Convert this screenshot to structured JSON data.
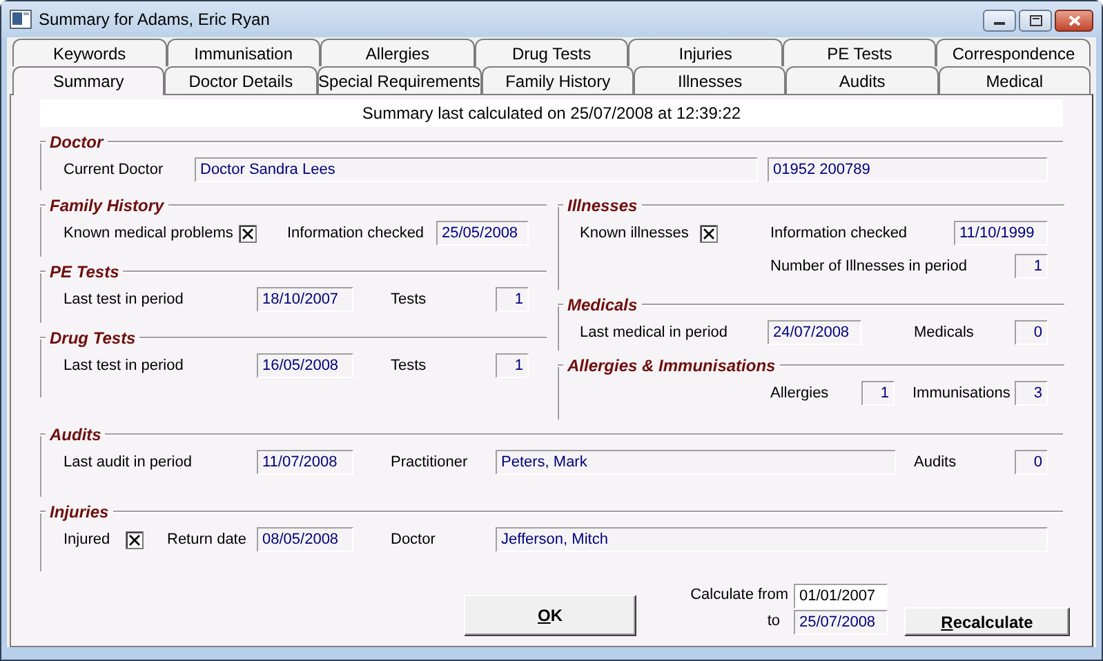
{
  "window": {
    "title": "Summary for Adams, Eric Ryan"
  },
  "tab_rows": [
    {
      "tabs": [
        {
          "label": "Keywords",
          "selected": false
        },
        {
          "label": "Immunisation",
          "selected": false
        },
        {
          "label": "Allergies",
          "selected": false
        },
        {
          "label": "Drug Tests",
          "selected": false
        },
        {
          "label": "Injuries",
          "selected": false
        },
        {
          "label": "PE Tests",
          "selected": false
        },
        {
          "label": "Correspondence",
          "selected": false
        }
      ]
    },
    {
      "tabs": [
        {
          "label": "Summary",
          "selected": true
        },
        {
          "label": "Doctor Details",
          "selected": false
        },
        {
          "label": "Special Requirements",
          "selected": false
        },
        {
          "label": "Family History",
          "selected": false
        },
        {
          "label": "Illnesses",
          "selected": false
        },
        {
          "label": "Audits",
          "selected": false
        },
        {
          "label": "Medical",
          "selected": false
        }
      ]
    }
  ],
  "summary_line": "Summary last calculated on 25/07/2008 at 12:39:22",
  "top_groups": [
    {
      "title": "Doctor",
      "rows": [
        [
          {
            "kind": "label",
            "text": "Current Doctor"
          },
          {
            "kind": "text",
            "value": "Doctor Sandra Lees"
          },
          {
            "kind": "text",
            "value": "01952 200789"
          }
        ]
      ]
    }
  ],
  "left_column": [
    {
      "title": "Family History",
      "rows": [
        [
          {
            "kind": "label",
            "text": "Known medical problems"
          },
          {
            "kind": "checkbox",
            "checked": true
          },
          {
            "kind": "label",
            "text": "Information checked"
          },
          {
            "kind": "date",
            "value": "25/05/2008"
          }
        ]
      ]
    },
    {
      "title": "PE Tests",
      "rows": [
        [
          {
            "kind": "label",
            "text": "Last test in period"
          },
          {
            "kind": "date",
            "value": "18/10/2007"
          },
          {
            "kind": "label",
            "text": "Tests"
          },
          {
            "kind": "number",
            "value": "1"
          }
        ]
      ]
    },
    {
      "title": "Drug Tests",
      "rows": [
        [
          {
            "kind": "label",
            "text": "Last test in period"
          },
          {
            "kind": "date",
            "value": "16/05/2008"
          },
          {
            "kind": "label",
            "text": "Tests"
          },
          {
            "kind": "number",
            "value": "1"
          }
        ]
      ]
    }
  ],
  "right_column": [
    {
      "title": "Illnesses",
      "rows": [
        [
          {
            "kind": "label",
            "text": "Known illnesses"
          },
          {
            "kind": "checkbox",
            "checked": true
          },
          {
            "kind": "label",
            "text": "Information checked"
          },
          {
            "kind": "date",
            "value": "11/10/1999"
          }
        ],
        [
          {
            "kind": "empty"
          },
          {
            "kind": "empty"
          },
          {
            "kind": "label",
            "text": "Number of Illnesses in period"
          },
          {
            "kind": "number",
            "value": "1"
          }
        ]
      ]
    },
    {
      "title": "Medicals",
      "rows": [
        [
          {
            "kind": "label",
            "text": "Last medical in period"
          },
          {
            "kind": "date",
            "value": "24/07/2008"
          },
          {
            "kind": "label",
            "text": "Medicals"
          },
          {
            "kind": "number",
            "value": "0"
          }
        ]
      ]
    },
    {
      "title": "Allergies & Immunisations",
      "rows": [
        [
          {
            "kind": "label",
            "text": "Allergies"
          },
          {
            "kind": "number",
            "value": "1"
          },
          {
            "kind": "label",
            "text": "Immunisations"
          },
          {
            "kind": "number",
            "value": "3"
          }
        ]
      ]
    }
  ],
  "bottom_groups": [
    {
      "title": "Audits",
      "rows": [
        [
          {
            "kind": "label",
            "text": "Last audit in period"
          },
          {
            "kind": "date",
            "value": "11/07/2008"
          },
          {
            "kind": "label",
            "text": "Practitioner"
          },
          {
            "kind": "text",
            "value": "Peters, Mark"
          },
          {
            "kind": "label",
            "text": "Audits"
          },
          {
            "kind": "number",
            "value": "0"
          }
        ]
      ]
    },
    {
      "title": "Injuries",
      "rows": [
        [
          {
            "kind": "label",
            "text": "Injured"
          },
          {
            "kind": "checkbox",
            "checked": true
          },
          {
            "kind": "label",
            "text": "Return date"
          },
          {
            "kind": "date",
            "value": "08/05/2008"
          },
          {
            "kind": "label",
            "text": "Doctor"
          },
          {
            "kind": "text",
            "value": "Jefferson, Mitch"
          }
        ]
      ]
    }
  ],
  "calculate": [
    {
      "label": "Calculate from",
      "value": "01/01/2007",
      "focused": true
    },
    {
      "label": "to",
      "value": "25/07/2008",
      "focused": false
    }
  ],
  "buttons": [
    {
      "label": "OK"
    },
    {
      "label": "Recalculate"
    }
  ]
}
